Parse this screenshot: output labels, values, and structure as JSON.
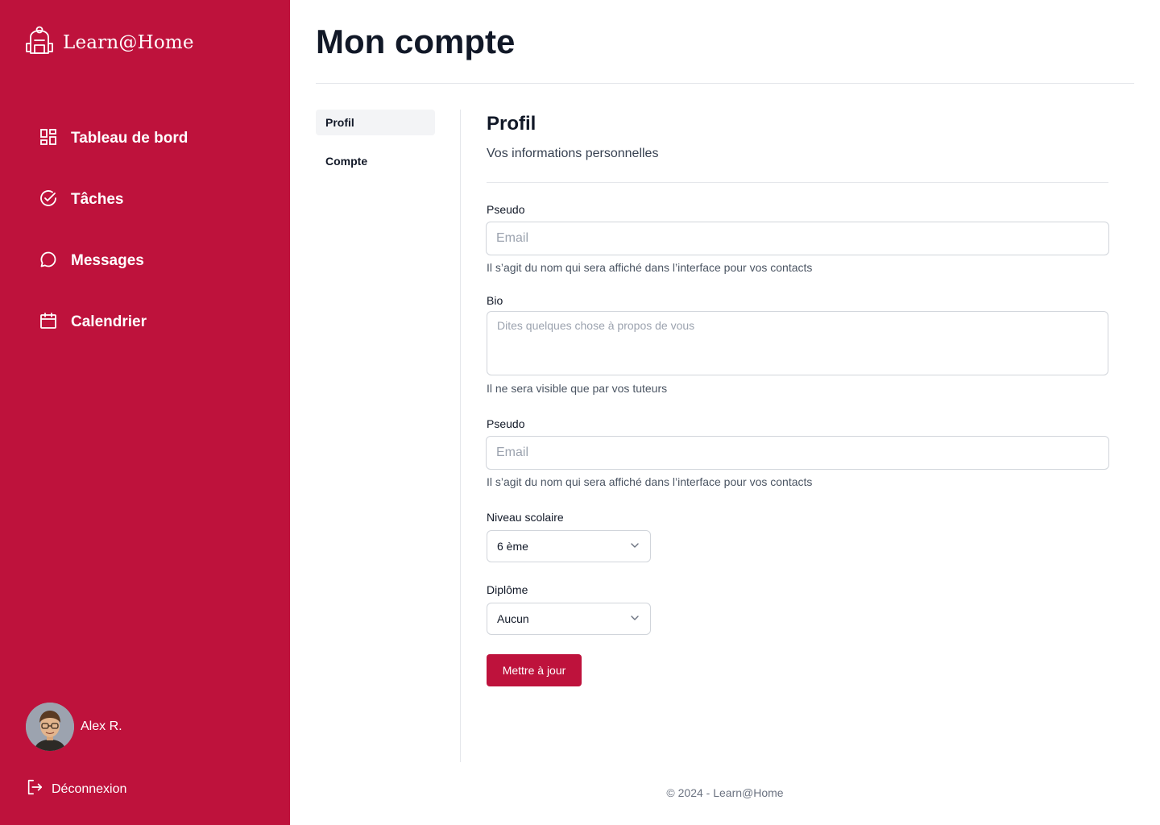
{
  "brand": {
    "name": "Learn@Home",
    "icon": "backpack-icon"
  },
  "sidebar": {
    "items": [
      {
        "label": "Tableau de bord",
        "icon": "dashboard-icon"
      },
      {
        "label": "Tâches",
        "icon": "check-circle-icon"
      },
      {
        "label": "Messages",
        "icon": "chat-bubble-icon"
      },
      {
        "label": "Calendrier",
        "icon": "calendar-icon"
      }
    ],
    "user": {
      "name": "Alex R."
    },
    "logout_label": "Déconnexion"
  },
  "page": {
    "title": "Mon compte"
  },
  "subnav": {
    "items": [
      {
        "label": "Profil"
      },
      {
        "label": "Compte"
      }
    ]
  },
  "profile": {
    "title": "Profil",
    "subtitle": "Vos informations personnelles",
    "pseudo1": {
      "label": "Pseudo",
      "placeholder": "Email",
      "value": "",
      "help": "Il s’agit du nom qui sera affiché dans l’interface pour vos contacts"
    },
    "bio": {
      "label": "Bio",
      "placeholder": "Dites quelques chose à propos de vous",
      "value": "",
      "help": "Il ne sera visible que par vos tuteurs"
    },
    "pseudo2": {
      "label": "Pseudo",
      "placeholder": "Email",
      "value": "",
      "help": "Il s’agit du nom qui sera affiché dans l’interface pour vos contacts"
    },
    "level": {
      "label": "Niveau scolaire",
      "selected": "6 ème"
    },
    "diploma": {
      "label": "Diplôme",
      "selected": "Aucun"
    },
    "submit_label": "Mettre à jour"
  },
  "footer": {
    "text": "© 2024 - Learn@Home"
  },
  "colors": {
    "accent": "#be123c",
    "border": "#d1d5db",
    "muted": "#6b7280"
  }
}
